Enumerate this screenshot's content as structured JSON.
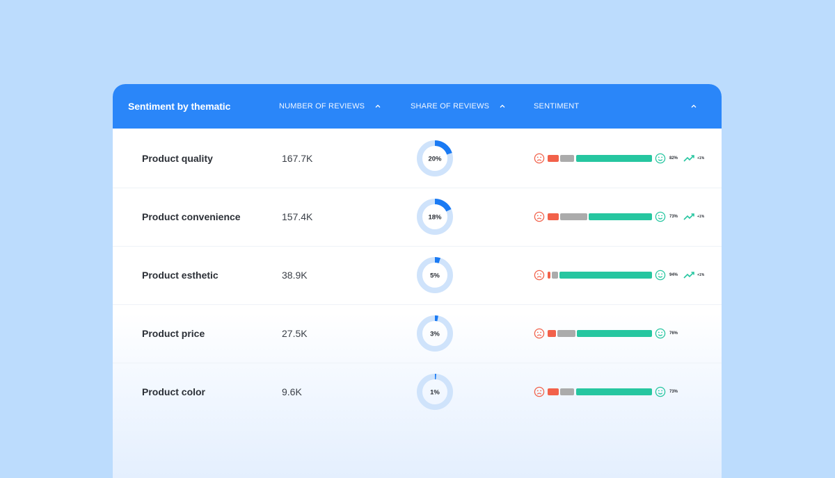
{
  "header": {
    "title": "Sentiment by thematic",
    "col_reviews": "NUMBER OF REVIEWS",
    "col_share": "SHARE OF REVIEWS",
    "col_sentiment": "SENTIMENT"
  },
  "colors": {
    "header_bg": "#2a86f9",
    "donut_fill": "#1a7af3",
    "donut_track": "#cfe3fb",
    "negative": "#f2614a",
    "neutral": "#ababab",
    "positive": "#26c6a0"
  },
  "rows": [
    {
      "name": "Product quality",
      "reviews": "167.7K",
      "share_label": "20%",
      "share": 0.2,
      "sentiment": {
        "neg": 0.11,
        "neu": 0.14,
        "pos": 0.75
      },
      "pct": "82%",
      "trend": "+1%"
    },
    {
      "name": "Product convenience",
      "reviews": "157.4K",
      "share_label": "18%",
      "share": 0.18,
      "sentiment": {
        "neg": 0.11,
        "neu": 0.27,
        "pos": 0.62
      },
      "pct": "73%",
      "trend": "+1%"
    },
    {
      "name": "Product esthetic",
      "reviews": "38.9K",
      "share_label": "5%",
      "share": 0.05,
      "sentiment": {
        "neg": 0.03,
        "neu": 0.06,
        "pos": 0.91
      },
      "pct": "94%",
      "trend": "+1%"
    },
    {
      "name": "Product price",
      "reviews": "27.5K",
      "share_label": "3%",
      "share": 0.03,
      "sentiment": {
        "neg": 0.08,
        "neu": 0.18,
        "pos": 0.74
      },
      "pct": "76%",
      "trend": null
    },
    {
      "name": "Product color",
      "reviews": "9.6K",
      "share_label": "1%",
      "share": 0.01,
      "sentiment": {
        "neg": 0.11,
        "neu": 0.14,
        "pos": 0.75
      },
      "pct": "73%",
      "trend": null
    }
  ]
}
